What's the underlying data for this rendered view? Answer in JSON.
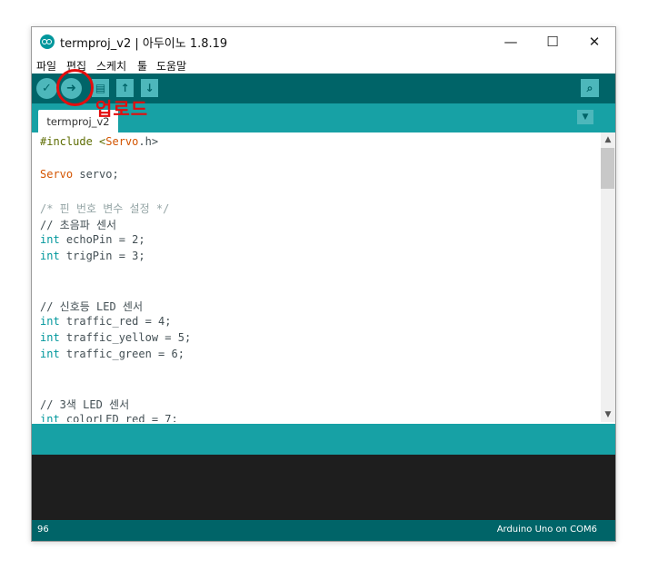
{
  "window": {
    "title": "termproj_v2 | 아두이노 1.8.19"
  },
  "window_controls": {
    "minimize": "—",
    "maximize": "☐",
    "close": "✕"
  },
  "menu": [
    "파일",
    "편집",
    "스케치",
    "툴",
    "도움말"
  ],
  "toolbar": {
    "verify_icon": "check-icon",
    "upload_icon": "arrow-right-icon",
    "new_icon": "file-icon",
    "open_icon": "arrow-up-icon",
    "save_icon": "arrow-down-icon",
    "serial_monitor_icon": "magnifier-icon"
  },
  "annotation": {
    "label": "업로드",
    "color": "#e30d0d"
  },
  "tab": {
    "label": "termproj_v2"
  },
  "code": [
    {
      "parts": [
        [
          "pre",
          "#include <"
        ],
        [
          "fn",
          "Servo"
        ],
        [
          "plain",
          ".h>"
        ]
      ]
    },
    {
      "parts": []
    },
    {
      "parts": [
        [
          "class",
          "Servo"
        ],
        [
          "plain",
          " servo;"
        ]
      ]
    },
    {
      "parts": []
    },
    {
      "parts": [
        [
          "comment",
          "/* 핀 번호 변수 설정 */"
        ]
      ]
    },
    {
      "parts": [
        [
          "plain",
          "// 초음파 센서"
        ]
      ]
    },
    {
      "parts": [
        [
          "type",
          "int"
        ],
        [
          "plain",
          " echoPin = 2;"
        ]
      ]
    },
    {
      "parts": [
        [
          "type",
          "int"
        ],
        [
          "plain",
          " trigPin = 3;"
        ]
      ]
    },
    {
      "parts": []
    },
    {
      "parts": []
    },
    {
      "parts": [
        [
          "plain",
          "// 신호등 LED 센서"
        ]
      ]
    },
    {
      "parts": [
        [
          "type",
          "int"
        ],
        [
          "plain",
          " traffic_red = 4;"
        ]
      ]
    },
    {
      "parts": [
        [
          "type",
          "int"
        ],
        [
          "plain",
          " traffic_yellow = 5;"
        ]
      ]
    },
    {
      "parts": [
        [
          "type",
          "int"
        ],
        [
          "plain",
          " traffic_green = 6;"
        ]
      ]
    },
    {
      "parts": []
    },
    {
      "parts": []
    },
    {
      "parts": [
        [
          "plain",
          "// 3색 LED 센서"
        ]
      ]
    },
    {
      "parts": [
        [
          "type",
          "int"
        ],
        [
          "plain",
          " colorLED_red = 7;"
        ]
      ]
    }
  ],
  "status": {
    "line": "96",
    "board": "Arduino Uno on COM6"
  },
  "colors": {
    "toolbar": "#006468",
    "tabbar": "#17a1a5",
    "accent": "#4db7bb"
  }
}
